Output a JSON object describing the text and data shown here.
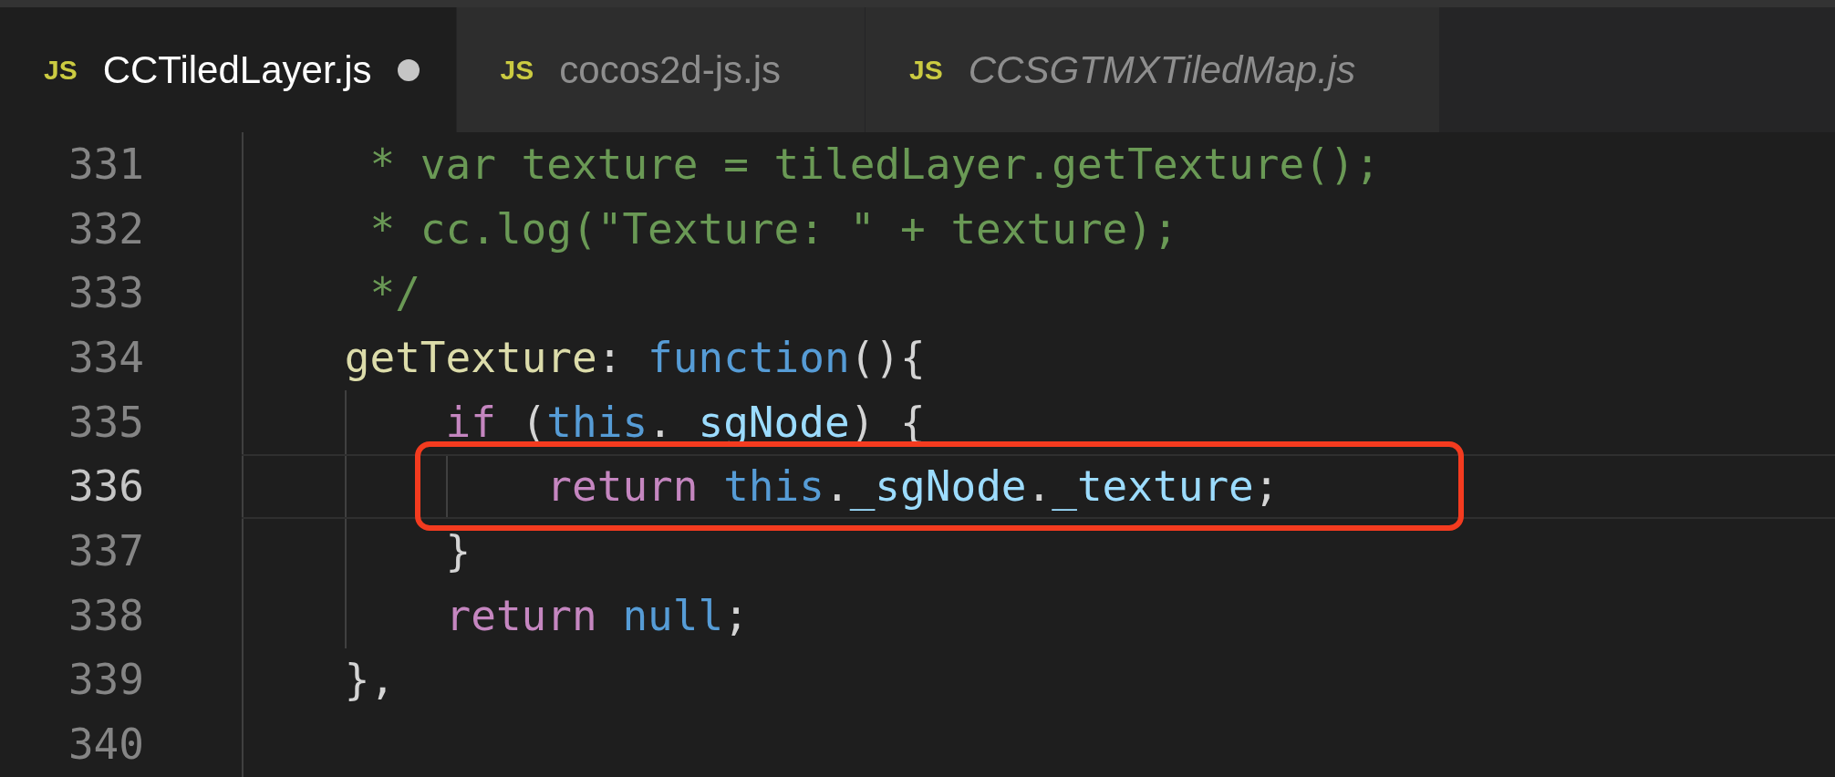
{
  "tabs": [
    {
      "icon_text": "JS",
      "label": "CCTiledLayer.js",
      "selected": true,
      "modified": true,
      "preview": false
    },
    {
      "icon_text": "JS",
      "label": "cocos2d-js.js",
      "selected": false,
      "modified": false,
      "preview": false
    },
    {
      "icon_text": "JS",
      "label": "CCSGTMXTiledMap.js",
      "selected": false,
      "modified": false,
      "preview": true
    }
  ],
  "editor": {
    "lines": [
      {
        "number": "331",
        "current": false,
        "annotated": false,
        "tokens": [
          {
            "kind": "comment",
            "text": "     * var texture = tiledLayer.getTexture();"
          }
        ]
      },
      {
        "number": "332",
        "current": false,
        "annotated": false,
        "tokens": [
          {
            "kind": "comment",
            "text": "     * cc.log(\"Texture: \" + texture);"
          }
        ]
      },
      {
        "number": "333",
        "current": false,
        "annotated": false,
        "tokens": [
          {
            "kind": "comment",
            "text": "     */"
          }
        ]
      },
      {
        "number": "334",
        "current": false,
        "annotated": false,
        "tokens": [
          {
            "kind": "function",
            "text": "    getTexture"
          },
          {
            "kind": "plain",
            "text": ": "
          },
          {
            "kind": "storage",
            "text": "function"
          },
          {
            "kind": "plain",
            "text": "(){"
          }
        ]
      },
      {
        "number": "335",
        "current": false,
        "annotated": false,
        "tokens": [
          {
            "kind": "keyword",
            "text": "        if"
          },
          {
            "kind": "plain",
            "text": " ("
          },
          {
            "kind": "storage",
            "text": "this"
          },
          {
            "kind": "plain",
            "text": ". "
          },
          {
            "kind": "property",
            "text": "sgNode"
          },
          {
            "kind": "plain",
            "text": ") {"
          }
        ]
      },
      {
        "number": "336",
        "current": true,
        "annotated": true,
        "tokens": [
          {
            "kind": "keyword",
            "text": "            return"
          },
          {
            "kind": "storage",
            "text": " this"
          },
          {
            "kind": "plain",
            "text": "."
          },
          {
            "kind": "property",
            "text": "_sgNode"
          },
          {
            "kind": "plain",
            "text": "."
          },
          {
            "kind": "property",
            "text": "_texture"
          },
          {
            "kind": "plain",
            "text": ";"
          }
        ]
      },
      {
        "number": "337",
        "current": false,
        "annotated": false,
        "tokens": [
          {
            "kind": "plain",
            "text": "        }"
          }
        ]
      },
      {
        "number": "338",
        "current": false,
        "annotated": false,
        "tokens": [
          {
            "kind": "keyword",
            "text": "        return"
          },
          {
            "kind": "storage",
            "text": " null"
          },
          {
            "kind": "plain",
            "text": ";"
          }
        ]
      },
      {
        "number": "339",
        "current": false,
        "annotated": false,
        "tokens": [
          {
            "kind": "plain",
            "text": "    },"
          }
        ]
      },
      {
        "number": "340",
        "current": false,
        "annotated": false
      }
    ]
  }
}
